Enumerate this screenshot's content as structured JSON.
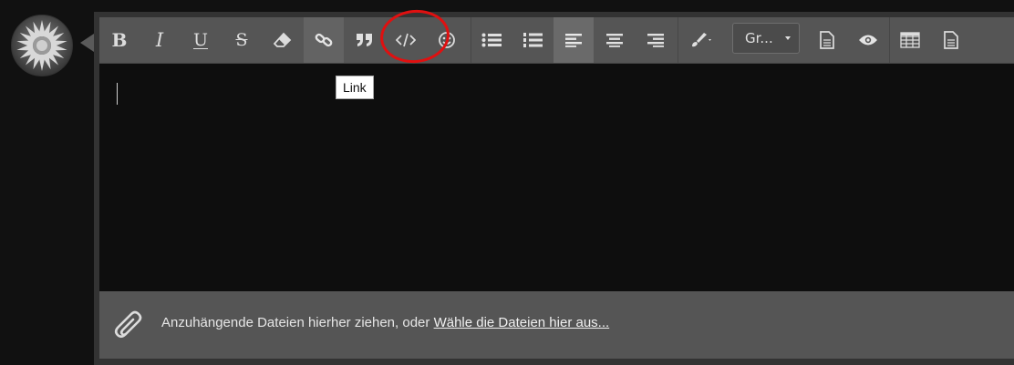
{
  "user": {
    "avatar_icon": "sunburst-avatar"
  },
  "toolbar": {
    "buttons": [
      {
        "id": "bold",
        "label": "B",
        "icon": "bold-icon"
      },
      {
        "id": "italic",
        "label": "I",
        "icon": "italic-icon"
      },
      {
        "id": "underline",
        "label": "U",
        "icon": "underline-icon"
      },
      {
        "id": "strike",
        "label": "S",
        "icon": "strikethrough-icon"
      },
      {
        "id": "clear",
        "icon": "eraser-icon"
      },
      {
        "id": "link",
        "icon": "link-icon"
      },
      {
        "id": "quote",
        "icon": "quote-icon"
      },
      {
        "id": "code",
        "icon": "code-icon"
      },
      {
        "id": "smilie",
        "icon": "smiley-icon"
      },
      {
        "id": "ul",
        "icon": "bullet-list-icon"
      },
      {
        "id": "ol",
        "icon": "numbered-list-icon"
      },
      {
        "id": "align-left",
        "icon": "align-left-icon",
        "active": true
      },
      {
        "id": "align-center",
        "icon": "align-center-icon"
      },
      {
        "id": "align-right",
        "icon": "align-right-icon"
      },
      {
        "id": "color",
        "icon": "paintbrush-icon"
      },
      {
        "id": "drafts",
        "icon": "document-icon"
      },
      {
        "id": "preview",
        "icon": "eye-icon"
      },
      {
        "id": "table",
        "icon": "table-icon"
      },
      {
        "id": "source",
        "icon": "file-icon"
      }
    ],
    "font_select_value": "Gr..."
  },
  "tooltip": {
    "text": "Link"
  },
  "attachments": {
    "prompt": "Anzuhängende Dateien hierher ziehen, oder ",
    "link": "Wähle die Dateien hier aus..."
  },
  "colors": {
    "highlight": "#e01010",
    "toolbar": "#555555",
    "content": "#0e0e0e"
  }
}
